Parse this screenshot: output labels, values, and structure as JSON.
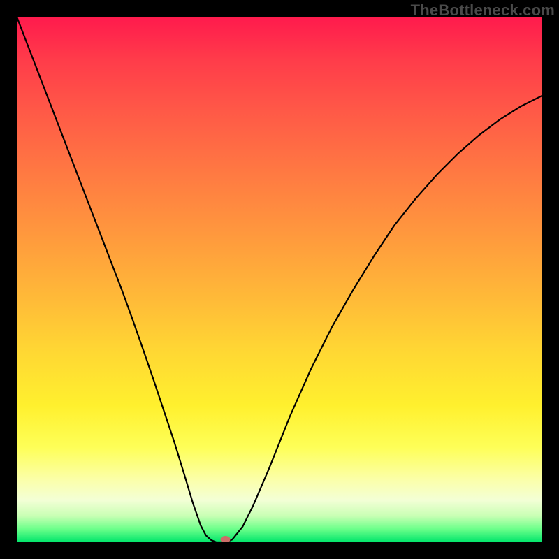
{
  "watermark": "TheBottleneck.com",
  "chart_data": {
    "type": "line",
    "title": "",
    "xlabel": "",
    "ylabel": "",
    "xlim": [
      0,
      1
    ],
    "ylim": [
      0,
      1
    ],
    "series": [
      {
        "name": "bottleneck-curve",
        "x": [
          0.0,
          0.02,
          0.04,
          0.06,
          0.08,
          0.1,
          0.12,
          0.14,
          0.16,
          0.18,
          0.2,
          0.22,
          0.24,
          0.26,
          0.28,
          0.3,
          0.32,
          0.335,
          0.35,
          0.36,
          0.37,
          0.38,
          0.39,
          0.397,
          0.41,
          0.43,
          0.45,
          0.48,
          0.52,
          0.56,
          0.6,
          0.64,
          0.68,
          0.72,
          0.76,
          0.8,
          0.84,
          0.88,
          0.92,
          0.96,
          1.0
        ],
        "y": [
          1.0,
          0.948,
          0.896,
          0.844,
          0.792,
          0.74,
          0.688,
          0.636,
          0.584,
          0.532,
          0.48,
          0.425,
          0.368,
          0.31,
          0.25,
          0.19,
          0.125,
          0.075,
          0.032,
          0.013,
          0.004,
          0.0,
          0.0,
          0.0,
          0.005,
          0.03,
          0.07,
          0.14,
          0.24,
          0.33,
          0.41,
          0.48,
          0.545,
          0.605,
          0.655,
          0.7,
          0.74,
          0.775,
          0.805,
          0.83,
          0.85
        ]
      }
    ],
    "marker": {
      "x": 0.397,
      "y": 0.0,
      "color": "#cc6d68"
    },
    "gradient_stops": [
      {
        "pos": 0.0,
        "color": "#ff1a4d"
      },
      {
        "pos": 0.5,
        "color": "#ffcc33"
      },
      {
        "pos": 0.82,
        "color": "#feff58"
      },
      {
        "pos": 1.0,
        "color": "#00e56b"
      }
    ]
  }
}
